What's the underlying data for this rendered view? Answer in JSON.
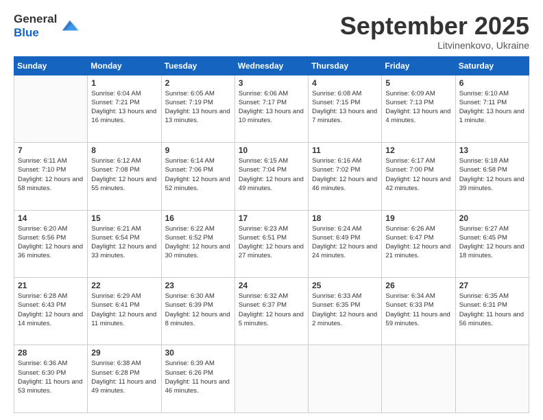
{
  "logo": {
    "line1": "General",
    "line2": "Blue"
  },
  "header": {
    "month": "September 2025",
    "location": "Litvinenkovo, Ukraine"
  },
  "weekdays": [
    "Sunday",
    "Monday",
    "Tuesday",
    "Wednesday",
    "Thursday",
    "Friday",
    "Saturday"
  ],
  "weeks": [
    [
      {
        "day": "",
        "info": ""
      },
      {
        "day": "1",
        "info": "Sunrise: 6:04 AM\nSunset: 7:21 PM\nDaylight: 13 hours\nand 16 minutes."
      },
      {
        "day": "2",
        "info": "Sunrise: 6:05 AM\nSunset: 7:19 PM\nDaylight: 13 hours\nand 13 minutes."
      },
      {
        "day": "3",
        "info": "Sunrise: 6:06 AM\nSunset: 7:17 PM\nDaylight: 13 hours\nand 10 minutes."
      },
      {
        "day": "4",
        "info": "Sunrise: 6:08 AM\nSunset: 7:15 PM\nDaylight: 13 hours\nand 7 minutes."
      },
      {
        "day": "5",
        "info": "Sunrise: 6:09 AM\nSunset: 7:13 PM\nDaylight: 13 hours\nand 4 minutes."
      },
      {
        "day": "6",
        "info": "Sunrise: 6:10 AM\nSunset: 7:11 PM\nDaylight: 13 hours\nand 1 minute."
      }
    ],
    [
      {
        "day": "7",
        "info": "Sunrise: 6:11 AM\nSunset: 7:10 PM\nDaylight: 12 hours\nand 58 minutes."
      },
      {
        "day": "8",
        "info": "Sunrise: 6:12 AM\nSunset: 7:08 PM\nDaylight: 12 hours\nand 55 minutes."
      },
      {
        "day": "9",
        "info": "Sunrise: 6:14 AM\nSunset: 7:06 PM\nDaylight: 12 hours\nand 52 minutes."
      },
      {
        "day": "10",
        "info": "Sunrise: 6:15 AM\nSunset: 7:04 PM\nDaylight: 12 hours\nand 49 minutes."
      },
      {
        "day": "11",
        "info": "Sunrise: 6:16 AM\nSunset: 7:02 PM\nDaylight: 12 hours\nand 46 minutes."
      },
      {
        "day": "12",
        "info": "Sunrise: 6:17 AM\nSunset: 7:00 PM\nDaylight: 12 hours\nand 42 minutes."
      },
      {
        "day": "13",
        "info": "Sunrise: 6:18 AM\nSunset: 6:58 PM\nDaylight: 12 hours\nand 39 minutes."
      }
    ],
    [
      {
        "day": "14",
        "info": "Sunrise: 6:20 AM\nSunset: 6:56 PM\nDaylight: 12 hours\nand 36 minutes."
      },
      {
        "day": "15",
        "info": "Sunrise: 6:21 AM\nSunset: 6:54 PM\nDaylight: 12 hours\nand 33 minutes."
      },
      {
        "day": "16",
        "info": "Sunrise: 6:22 AM\nSunset: 6:52 PM\nDaylight: 12 hours\nand 30 minutes."
      },
      {
        "day": "17",
        "info": "Sunrise: 6:23 AM\nSunset: 6:51 PM\nDaylight: 12 hours\nand 27 minutes."
      },
      {
        "day": "18",
        "info": "Sunrise: 6:24 AM\nSunset: 6:49 PM\nDaylight: 12 hours\nand 24 minutes."
      },
      {
        "day": "19",
        "info": "Sunrise: 6:26 AM\nSunset: 6:47 PM\nDaylight: 12 hours\nand 21 minutes."
      },
      {
        "day": "20",
        "info": "Sunrise: 6:27 AM\nSunset: 6:45 PM\nDaylight: 12 hours\nand 18 minutes."
      }
    ],
    [
      {
        "day": "21",
        "info": "Sunrise: 6:28 AM\nSunset: 6:43 PM\nDaylight: 12 hours\nand 14 minutes."
      },
      {
        "day": "22",
        "info": "Sunrise: 6:29 AM\nSunset: 6:41 PM\nDaylight: 12 hours\nand 11 minutes."
      },
      {
        "day": "23",
        "info": "Sunrise: 6:30 AM\nSunset: 6:39 PM\nDaylight: 12 hours\nand 8 minutes."
      },
      {
        "day": "24",
        "info": "Sunrise: 6:32 AM\nSunset: 6:37 PM\nDaylight: 12 hours\nand 5 minutes."
      },
      {
        "day": "25",
        "info": "Sunrise: 6:33 AM\nSunset: 6:35 PM\nDaylight: 12 hours\nand 2 minutes."
      },
      {
        "day": "26",
        "info": "Sunrise: 6:34 AM\nSunset: 6:33 PM\nDaylight: 11 hours\nand 59 minutes."
      },
      {
        "day": "27",
        "info": "Sunrise: 6:35 AM\nSunset: 6:31 PM\nDaylight: 11 hours\nand 56 minutes."
      }
    ],
    [
      {
        "day": "28",
        "info": "Sunrise: 6:36 AM\nSunset: 6:30 PM\nDaylight: 11 hours\nand 53 minutes."
      },
      {
        "day": "29",
        "info": "Sunrise: 6:38 AM\nSunset: 6:28 PM\nDaylight: 11 hours\nand 49 minutes."
      },
      {
        "day": "30",
        "info": "Sunrise: 6:39 AM\nSunset: 6:26 PM\nDaylight: 11 hours\nand 46 minutes."
      },
      {
        "day": "",
        "info": ""
      },
      {
        "day": "",
        "info": ""
      },
      {
        "day": "",
        "info": ""
      },
      {
        "day": "",
        "info": ""
      }
    ]
  ]
}
